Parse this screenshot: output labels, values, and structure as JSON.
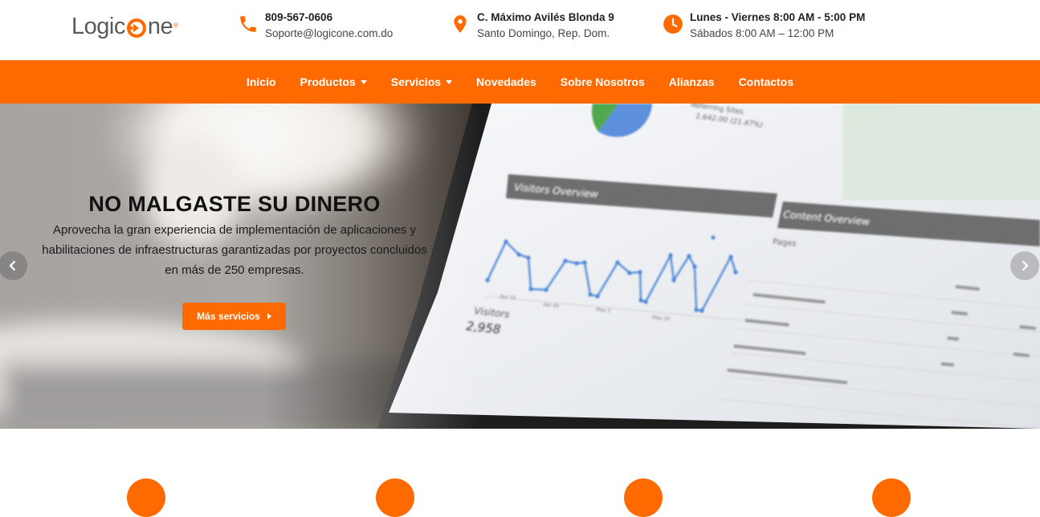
{
  "brand": {
    "logo_left": "Logic",
    "logo_right": "ne",
    "logo_reg": "®",
    "accent": "#ff6a00"
  },
  "contact": {
    "phone": "809-567-0606",
    "email": "Soporte@logicone.com.do",
    "address_line1": "C. Máximo Avilés Blonda 9",
    "address_line2": "Santo Domingo, Rep. Dom.",
    "hours_line1": "Lunes - Viernes 8:00 AM - 5:00 PM",
    "hours_line2": "Sábados 8:00 AM – 12:00 PM"
  },
  "nav": {
    "inicio": "Inicio",
    "productos": "Productos",
    "servicios": "Servicios",
    "novedades": "Novedades",
    "sobre": "Sobre Nosotros",
    "alianzas": "Alianzas",
    "contactos": "Contactos"
  },
  "hero": {
    "title": "NO MALGASTE SU DINERO",
    "description": "Aprovecha la gran experiencia de implementación de aplicaciones y habilitaciones de infraestructuras garantizadas por proyectos concluidos en más de 250 empresas.",
    "cta_label": "Más servicios"
  },
  "screen": {
    "visitors_overview": "Visitors Overview",
    "content_overview": "Content Overview",
    "pages": "Pages",
    "visitors_label": "Visitors",
    "visitors_value": "2,958",
    "referring_sites": "Referring Sites",
    "referring_value": "1,642.00 (21.47%)",
    "date1": "Apr 19",
    "date2": "Apr 26",
    "date3": "May 3",
    "date4": "May 10"
  },
  "icons": [
    "phone-icon",
    "location-pin-icon",
    "clock-icon",
    "chevron-left-icon",
    "chevron-right-icon",
    "caret-right-icon"
  ]
}
